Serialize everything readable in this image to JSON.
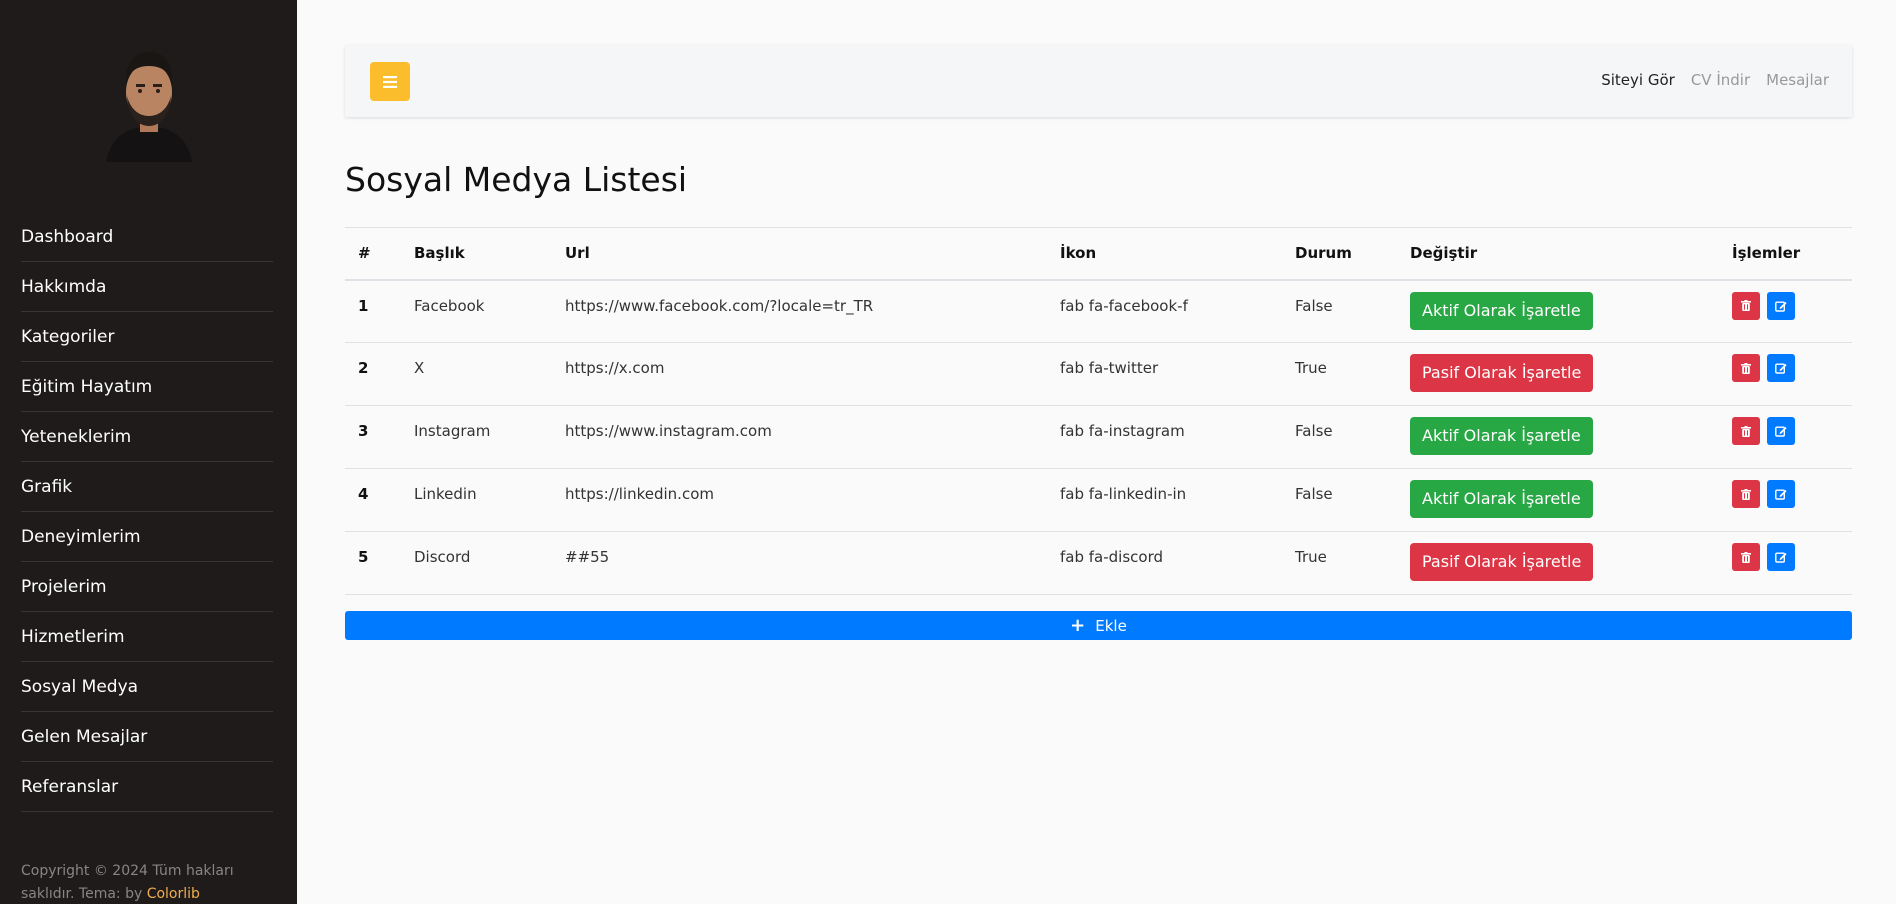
{
  "sidebar": {
    "items": [
      {
        "label": "Dashboard"
      },
      {
        "label": "Hakkımda"
      },
      {
        "label": "Kategoriler"
      },
      {
        "label": "Eğitim Hayatım"
      },
      {
        "label": "Yeteneklerim"
      },
      {
        "label": "Grafik"
      },
      {
        "label": "Deneyimlerim"
      },
      {
        "label": "Projelerim"
      },
      {
        "label": "Hizmetlerim"
      },
      {
        "label": "Sosyal Medya"
      },
      {
        "label": "Gelen Mesajlar"
      },
      {
        "label": "Referanslar"
      }
    ],
    "copyright_text": "Copyright © 2024 Tüm hakları saklıdır. Tema: by ",
    "copyright_link": "Colorlib"
  },
  "topbar": {
    "toggle_icon": "bars-icon",
    "links": [
      {
        "label": "Siteyi Gör"
      },
      {
        "label": "CV İndir"
      },
      {
        "label": "Mesajlar"
      }
    ]
  },
  "main": {
    "title": "Sosyal Medya Listesi",
    "columns": [
      "#",
      "Başlık",
      "Url",
      "İkon",
      "Durum",
      "Değiştir",
      "İşlemler"
    ],
    "rows": [
      {
        "num": "1",
        "title": "Facebook",
        "url": "https://www.facebook.com/?locale=tr_TR",
        "icon": "fab fa-facebook-f",
        "status": "False",
        "action": "Aktif Olarak İşaretle"
      },
      {
        "num": "2",
        "title": "X",
        "url": "https://x.com",
        "icon": "fab fa-twitter",
        "status": "True",
        "action": "Pasif Olarak İşaretle"
      },
      {
        "num": "3",
        "title": "Instagram",
        "url": "https://www.instagram.com",
        "icon": "fab fa-instagram",
        "status": "False",
        "action": "Aktif Olarak İşaretle"
      },
      {
        "num": "4",
        "title": "Linkedin",
        "url": "https://linkedin.com",
        "icon": "fab fa-linkedin-in",
        "status": "False",
        "action": "Aktif Olarak İşaretle"
      },
      {
        "num": "5",
        "title": "Discord",
        "url": "##55",
        "icon": "fab fa-discord",
        "status": "True",
        "action": "Pasif Olarak İşaretle"
      }
    ],
    "add_label": "Ekle"
  },
  "colors": {
    "sidebar_bg": "#1f1b1b",
    "accent_yellow": "#fbbd2b",
    "success": "#28a745",
    "danger": "#dc3545",
    "primary": "#007bff"
  }
}
